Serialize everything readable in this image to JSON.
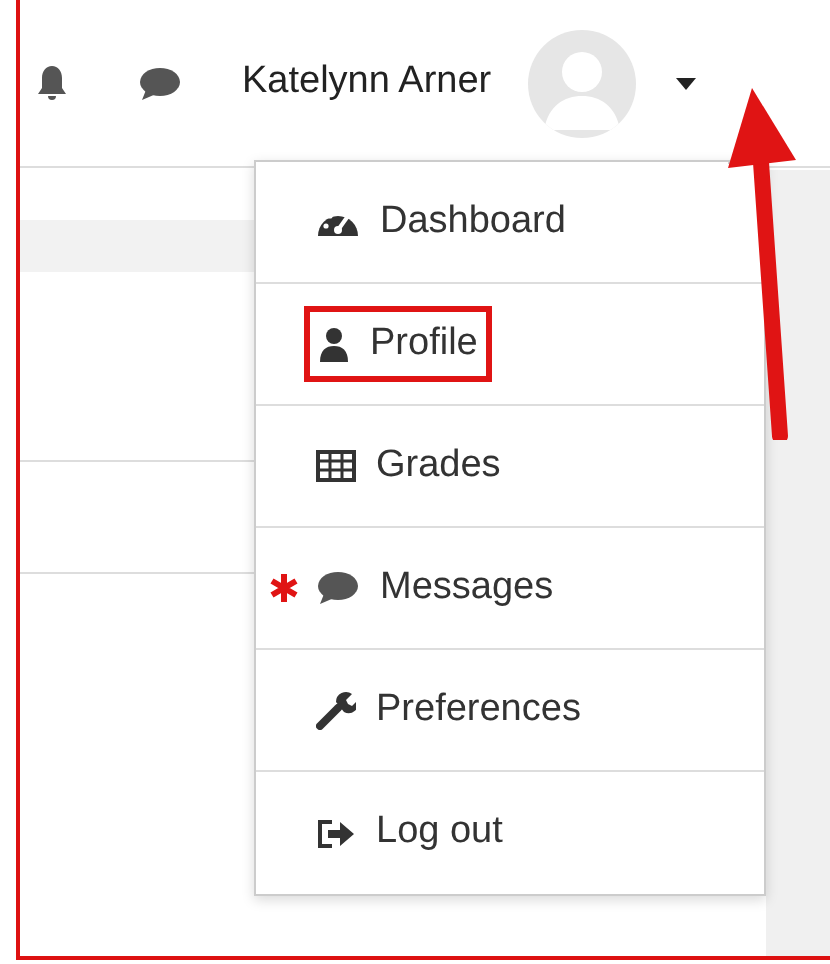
{
  "navbar": {
    "user_name": "Katelynn Arner",
    "menu_pointed_by_arrow": true
  },
  "user_menu": {
    "expanded": true,
    "items": [
      {
        "label": "Dashboard",
        "kind": "dashboard",
        "highlighted": false,
        "starred": false
      },
      {
        "label": "Profile",
        "kind": "user",
        "highlighted": true,
        "starred": false
      },
      {
        "label": "Grades",
        "kind": "table",
        "highlighted": false,
        "starred": false
      },
      {
        "label": "Messages",
        "kind": "chat",
        "highlighted": false,
        "starred": true
      },
      {
        "label": "Preferences",
        "kind": "wrench",
        "highlighted": false,
        "starred": false
      },
      {
        "label": "Log out",
        "kind": "logout",
        "highlighted": false,
        "starred": false
      }
    ]
  }
}
